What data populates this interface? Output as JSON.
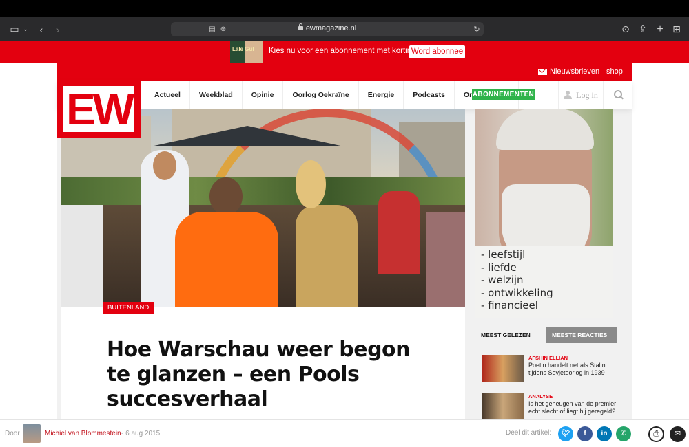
{
  "browser": {
    "url": "ewmagazine.nl"
  },
  "promo": {
    "book_title": "Lale Gül",
    "text": "Kies nu voor een abonnement met korting",
    "button": "Word abonnee"
  },
  "site": {
    "logo": "EW",
    "topbar": {
      "newsletters": "Nieuwsbrieven",
      "shop": "shop"
    },
    "nav": {
      "items": [
        {
          "label": "Actueel"
        },
        {
          "label": "Weekblad"
        },
        {
          "label": "Opinie"
        },
        {
          "label": "Oorlog Oekraïne"
        },
        {
          "label": "Energie"
        },
        {
          "label": "Podcasts"
        },
        {
          "label": "Onderzoeken"
        }
      ],
      "subscribe": "ABONNEMENTEN",
      "login": "Log in"
    }
  },
  "article": {
    "category": "BUITENLAND",
    "headline": "Hoe Warschau weer begon te glanzen – een Pools succesverhaal"
  },
  "ad": {
    "items": [
      "- leefstijl",
      "- liefde",
      "- welzijn",
      "- ontwikkeling",
      "- financieel"
    ]
  },
  "sidebar": {
    "tabs": [
      "MEEST GELEZEN",
      "MEESTE REACTIES"
    ],
    "items": [
      {
        "category": "AFSHIN ELLIAN",
        "title": "Poetin handelt net als Stalin tijdens Sovjetoorlog in 1939"
      },
      {
        "category": "ANALYSE",
        "title": "Is het geheugen van de premier echt slecht of liegt hij geregeld?"
      }
    ]
  },
  "byline": {
    "prefix": "Door",
    "author": "Michiel van Blommestein",
    "date": "- 6 aug 2015",
    "share_label": "Deel dit artikel:"
  },
  "colors": {
    "brand_red": "#e3000f",
    "subscribe_green": "#2fb34a",
    "twitter": "#1da1f2",
    "facebook": "#3b5998",
    "linkedin": "#0077b5",
    "whatsapp": "#25a56a"
  }
}
